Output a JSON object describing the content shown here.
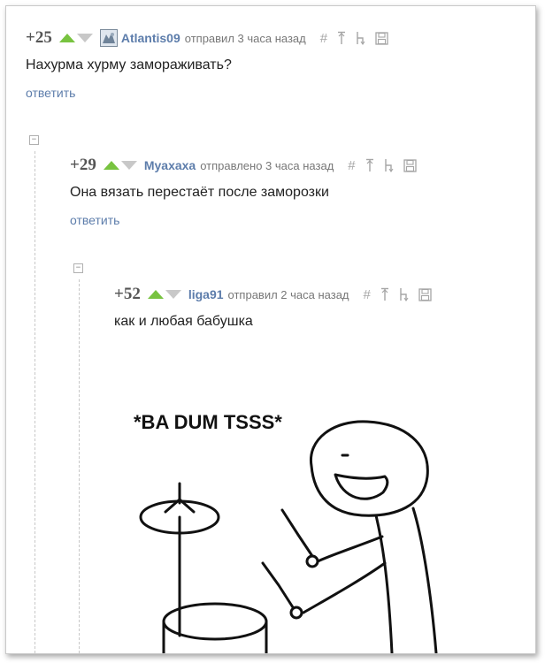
{
  "comments": [
    {
      "rating": "+25",
      "author": "Atlantis09",
      "time": "отправил 3 часа назад",
      "text": "Нахурма хурму замораживать?",
      "reply": "ответить"
    },
    {
      "rating": "+29",
      "author": "Myaxaxa",
      "time": "отправлено 3 часа назад",
      "text": "Она вязать перестаёт после заморозки",
      "reply": "ответить"
    },
    {
      "rating": "+52",
      "author": "liga91",
      "time": "отправил 2 часа назад",
      "text": "как и любая бабушка"
    }
  ],
  "tools": {
    "hash": "#",
    "collapse_symbol": "⊟"
  },
  "meme": {
    "caption": "*BA DUM TSSS*"
  },
  "colors": {
    "upvote": "#78c340",
    "downvote": "#c8c8c8",
    "link": "#5d7dab"
  },
  "icons": [
    "upvote-arrow-icon",
    "downvote-arrow-icon",
    "avatar-icon",
    "hash-icon",
    "arrow-up-icon",
    "parent-arrow-icon",
    "save-icon",
    "collapse-icon"
  ]
}
